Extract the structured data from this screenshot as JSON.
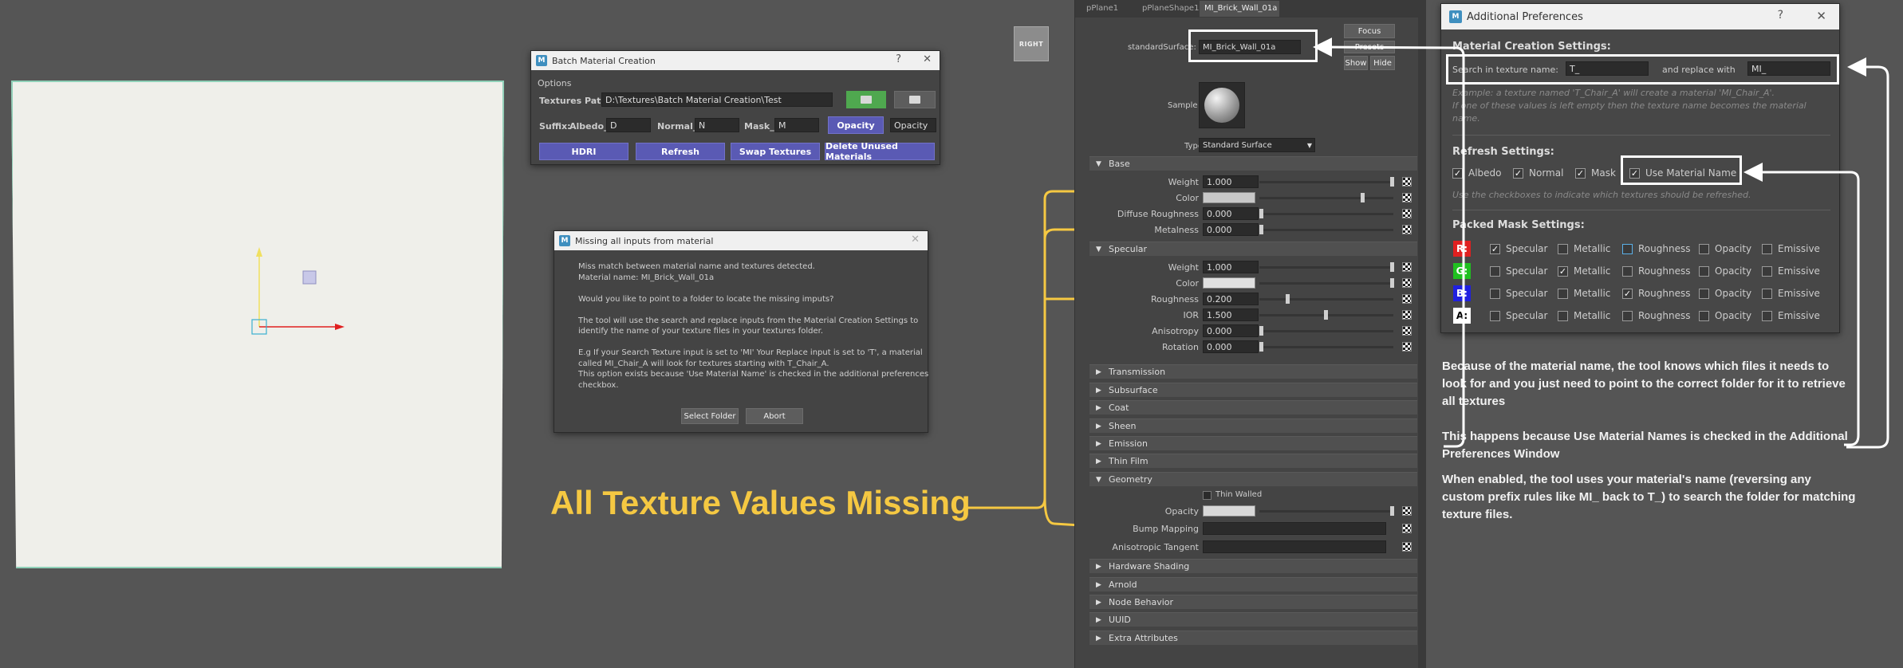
{
  "viewport": {
    "view_cube_label": "RIGHT"
  },
  "batch": {
    "title": "Batch Material Creation",
    "menu": "Options",
    "textures_path_label": "Textures Path:",
    "textures_path_value": "D:\\Textures\\Batch Material Creation\\Test",
    "suffix_label": "Suffix:",
    "albedo_label": "Albedo_",
    "albedo_value": "D",
    "normal_label": "Normal_",
    "normal_value": "N",
    "mask_label": "Mask_",
    "mask_value": "M",
    "opacity_button": "Opacity",
    "opacity_value": "Opacity",
    "buttons": [
      "HDRI",
      "Refresh",
      "Swap Textures",
      "Delete Unused Materials"
    ]
  },
  "missing": {
    "title": "Missing all inputs from material",
    "lines": [
      "Miss match between material name and textures detected.",
      "Material name: MI_Brick_Wall_01a",
      "",
      "Would you like to point to a folder to locate the missing imputs?",
      "",
      "The tool will use the search and replace inputs from the Material Creation Settings to",
      "identify the name of your texture files in your textures folder.",
      "",
      "E.g If your Search Texture input is set to 'MI' Your Replace input is set to 'T', a material",
      "called MI_Chair_A will look for textures starting with T_Chair_A.",
      "This option exists because 'Use Material Name' is checked in the additional preferences",
      "checkbox."
    ],
    "select_folder": "Select Folder",
    "abort": "Abort"
  },
  "callout": {
    "text": "All Texture Values Missing",
    "color": "#f5c842"
  },
  "attr": {
    "tabs": [
      "pPlane1",
      "pPlaneShape1",
      "MI_Brick_Wall_01a"
    ],
    "node_type": "standardSurface:",
    "node_name": "MI_Brick_Wall_01a",
    "focus": "Focus",
    "presets": "Presets",
    "show": "Show",
    "hide": "Hide",
    "sample": "Sample",
    "type_label": "Type",
    "type_value": "Standard Surface",
    "base": "Base",
    "weight": "Weight",
    "color": "Color",
    "diffuse_roughness": "Diffuse Roughness",
    "metalness": "Metalness",
    "specular": "Specular",
    "roughness": "Roughness",
    "ior": "IOR",
    "anisotropy": "Anisotropy",
    "rotation": "Rotation",
    "base_values": {
      "weight": "1.000",
      "diffuse_roughness": "0.000",
      "metalness": "0.000"
    },
    "spec_values": {
      "weight": "1.000",
      "roughness": "0.200",
      "ior": "1.500",
      "anisotropy": "0.000",
      "rotation": "0.000"
    },
    "collapsed": [
      "Transmission",
      "Subsurface",
      "Coat",
      "Sheen",
      "Emission",
      "Thin Film"
    ],
    "geometry": "Geometry",
    "thin_walled": "Thin Walled",
    "opacity": "Opacity",
    "bump_mapping": "Bump Mapping",
    "anisotropic_tangent": "Anisotropic Tangent",
    "bottom": [
      "Hardware Shading",
      "Arnold",
      "Node Behavior",
      "UUID",
      "Extra Attributes"
    ]
  },
  "prefs": {
    "title": "Additional Preferences",
    "creation_header": "Material Creation Settings:",
    "search_label": "Search in texture name:",
    "search_value": "T_",
    "replace_label": "and replace with",
    "replace_value": "MI_",
    "example_lines": [
      "Example: a texture named 'T_Chair_A' will create a material 'MI_Chair_A'.",
      "If one of these values is left empty then the texture name becomes the material",
      "name."
    ],
    "refresh_header": "Refresh Settings:",
    "refresh_items": [
      "Albedo",
      "Normal",
      "Mask",
      "Use Material Name"
    ],
    "refresh_hint": "Use the checkboxes to indicate which textures should be refreshed.",
    "packed_header": "Packed Mask Settings:",
    "channels": [
      "R:",
      "G:",
      "B:",
      "A:"
    ],
    "channel_colors": [
      "#e02020",
      "#20c020",
      "#2020e0",
      "#ffffff"
    ],
    "options": [
      "Specular",
      "Metallic",
      "Roughness",
      "Opacity",
      "Emissive"
    ]
  },
  "notes": [
    "Because of the material name, the tool knows which files it needs to look for and you just need to point to the correct folder for it to retrieve all textures",
    "This happens because Use Material Names is checked in the Additional Preferences Window",
    "When enabled, the tool uses your material's name (reversing any custom prefix rules like MI_ back to T_) to search the folder for matching texture files."
  ]
}
